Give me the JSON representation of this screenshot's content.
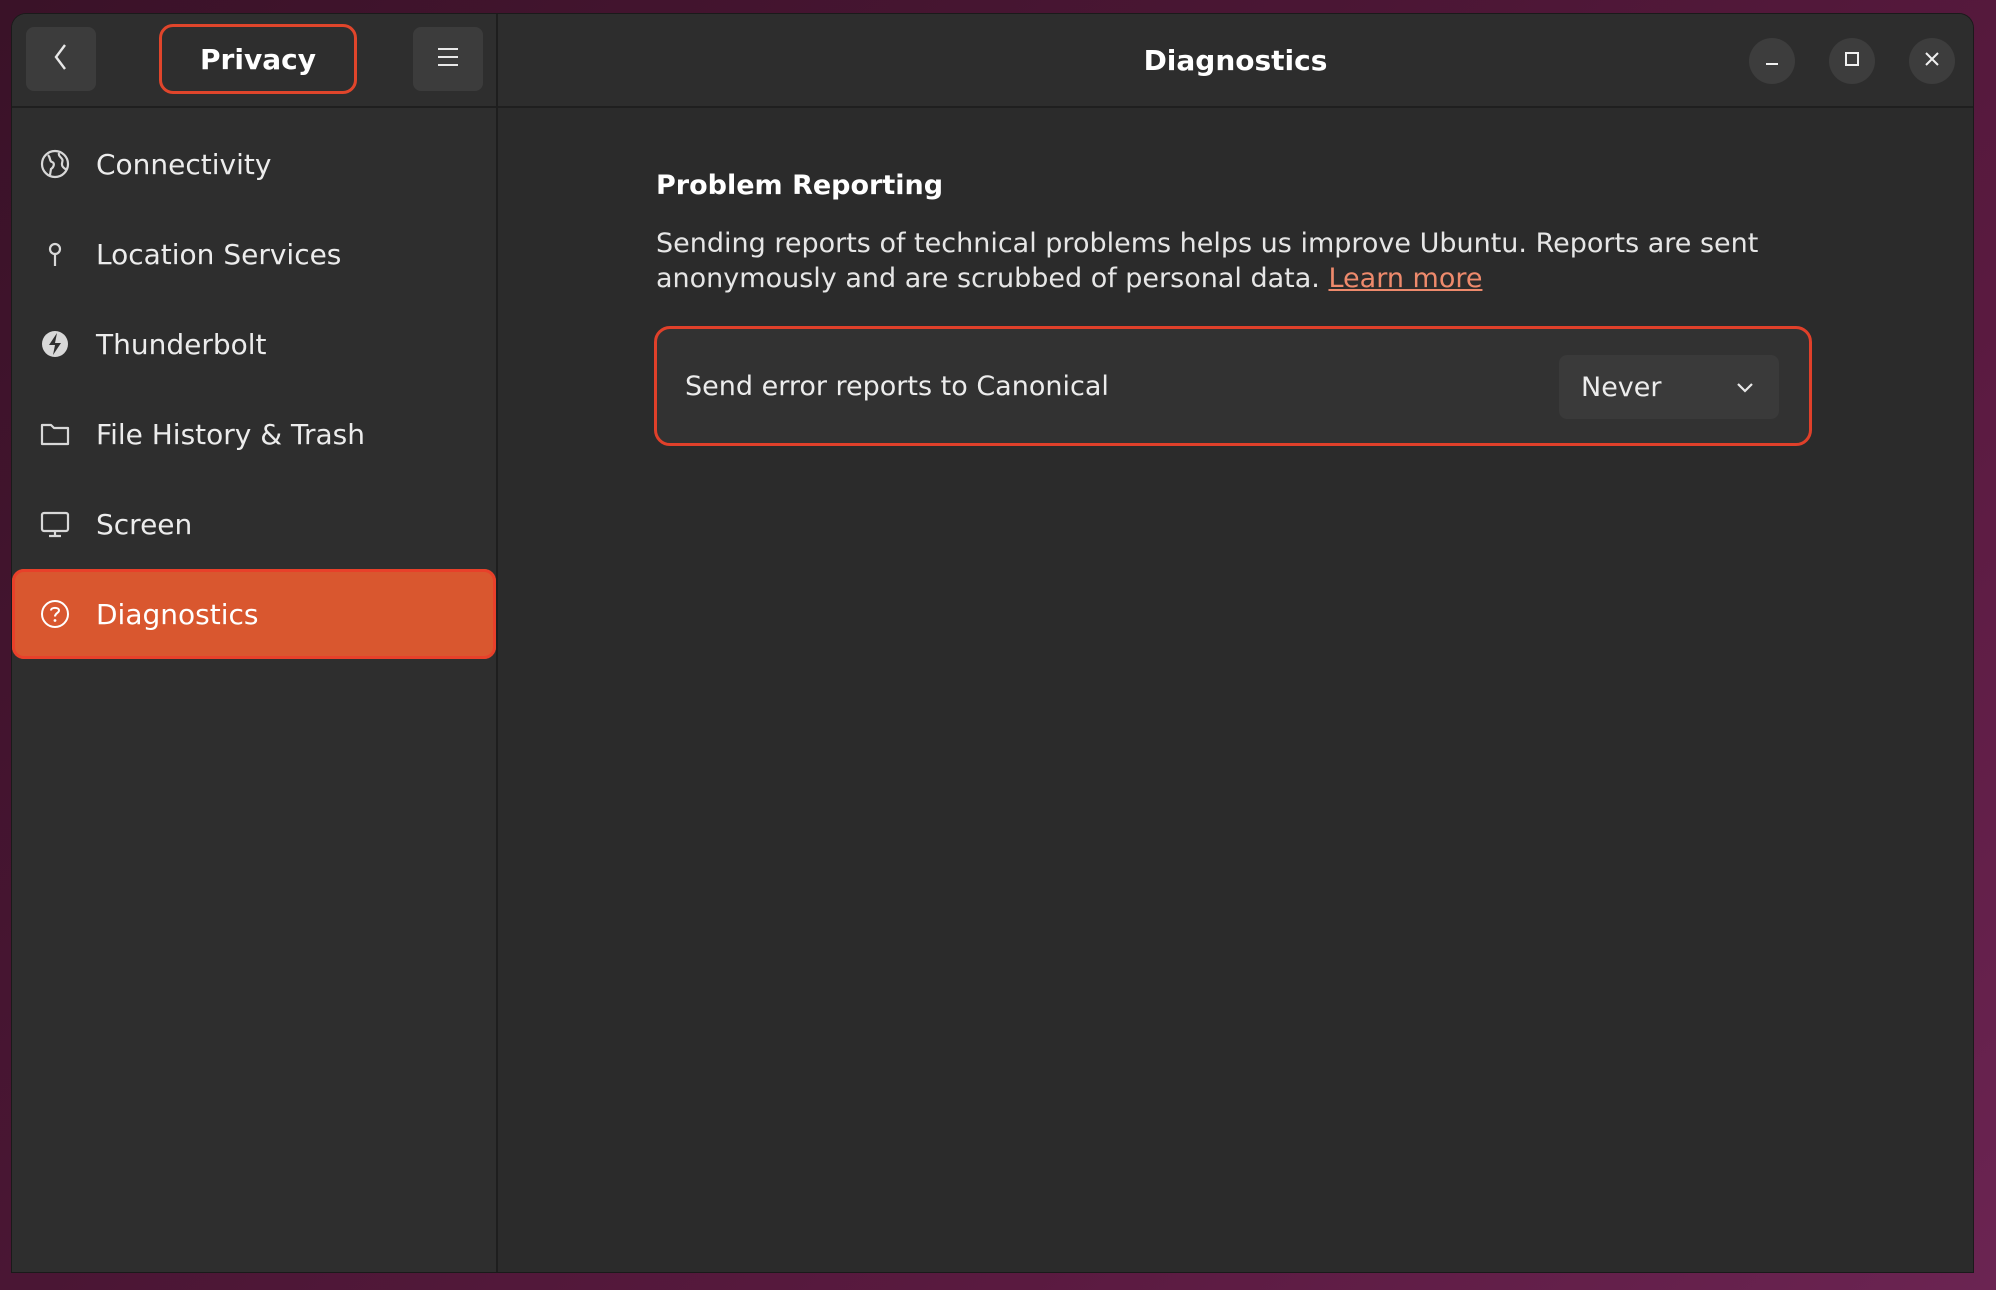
{
  "sidebar": {
    "title": "Privacy",
    "back_icon": "chevron-left-icon",
    "menu_icon": "hamburger-menu-icon",
    "items": [
      {
        "label": "Connectivity",
        "icon": "globe-icon"
      },
      {
        "label": "Location Services",
        "icon": "location-pin-icon"
      },
      {
        "label": "Thunderbolt",
        "icon": "thunderbolt-icon"
      },
      {
        "label": "File History & Trash",
        "icon": "folder-icon"
      },
      {
        "label": "Screen",
        "icon": "monitor-icon"
      },
      {
        "label": "Diagnostics",
        "icon": "help-circle-icon",
        "active": true
      }
    ]
  },
  "header": {
    "title": "Diagnostics",
    "window_controls": [
      "minimize-icon",
      "maximize-icon",
      "close-icon"
    ]
  },
  "main": {
    "section_title": "Problem Reporting",
    "description": "Sending reports of technical problems helps us improve Ubuntu. Reports are sent anonymously and are scrubbed of personal data.",
    "learn_more": "Learn more",
    "setting": {
      "label": "Send error reports to Canonical",
      "value": "Never"
    }
  },
  "colors": {
    "accent": "#d9572f",
    "highlight_outline": "#e0402a",
    "link": "#ee8a6c",
    "window_bg": "#2d2d2d"
  }
}
